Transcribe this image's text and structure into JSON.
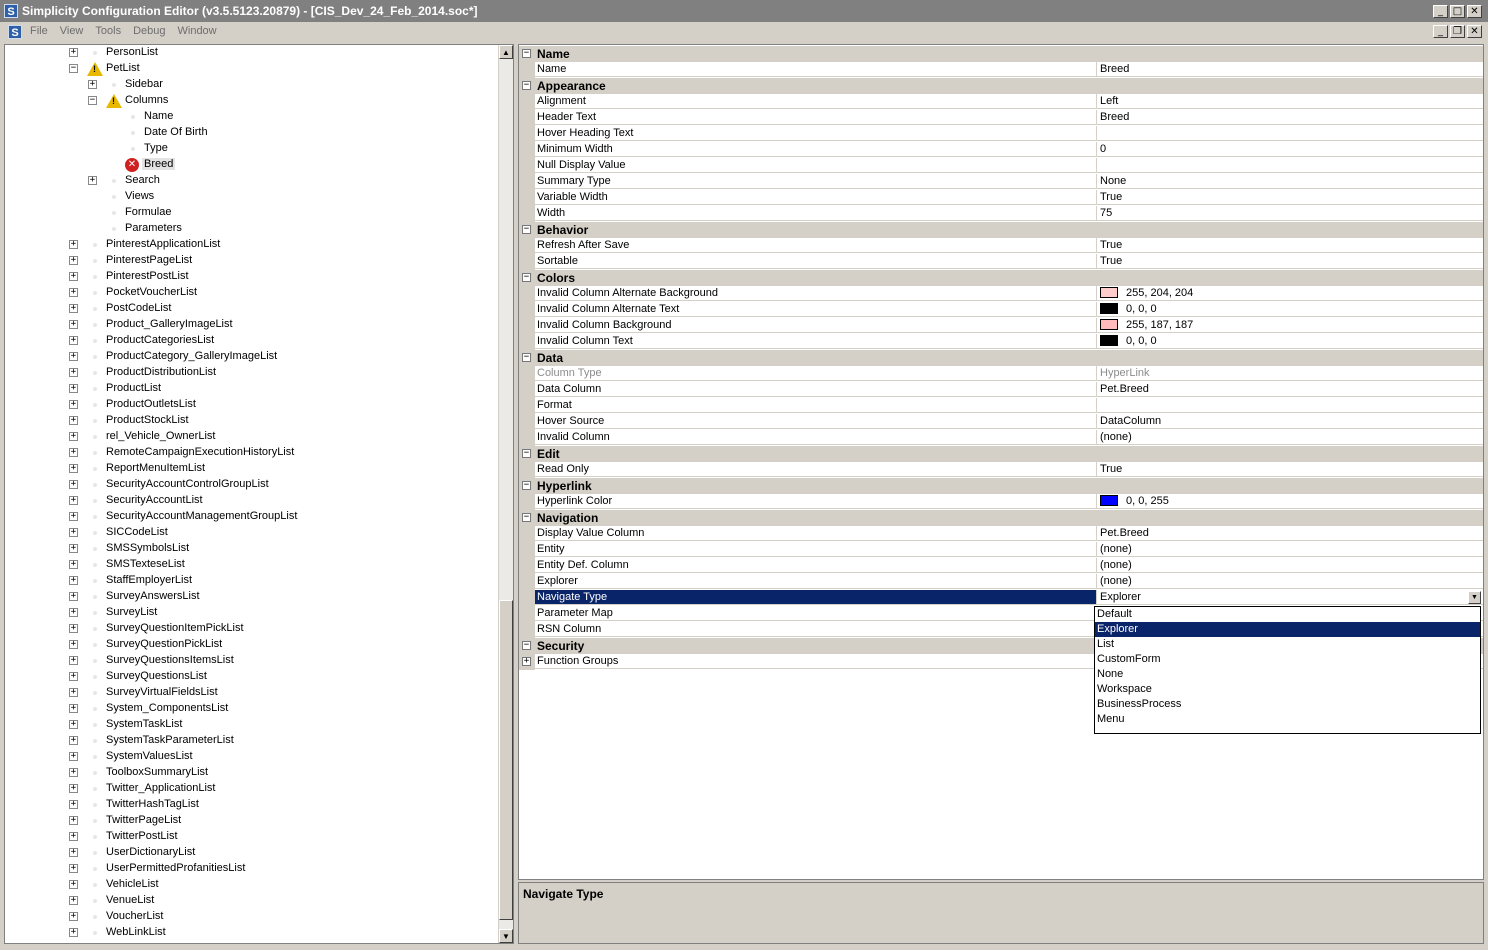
{
  "window": {
    "title": "Simplicity Configuration Editor (v3.5.5123.20879) - [CIS_Dev_24_Feb_2014.soc*]",
    "app_icon": "S",
    "minimize": "_",
    "maximize": "□",
    "restore": "❐",
    "close": "✕"
  },
  "menubar": {
    "items": [
      "File",
      "View",
      "Tools",
      "Debug",
      "Window"
    ]
  },
  "tree": {
    "items": [
      {
        "label": "PersonList",
        "level": 0,
        "expander": "+",
        "icon": "dot"
      },
      {
        "label": "PetList",
        "level": 0,
        "expander": "−",
        "icon": "warning"
      },
      {
        "label": "Sidebar",
        "level": 1,
        "expander": "+",
        "icon": "dot"
      },
      {
        "label": "Columns",
        "level": 1,
        "expander": "−",
        "icon": "warning"
      },
      {
        "label": "Name",
        "level": 2,
        "expander": "",
        "icon": "dot"
      },
      {
        "label": "Date Of Birth",
        "level": 2,
        "expander": "",
        "icon": "dot"
      },
      {
        "label": "Type",
        "level": 2,
        "expander": "",
        "icon": "dot"
      },
      {
        "label": "Breed",
        "level": 2,
        "expander": "",
        "icon": "error",
        "selected": true
      },
      {
        "label": "Search",
        "level": 1,
        "expander": "+",
        "icon": "dot"
      },
      {
        "label": "Views",
        "level": 1,
        "expander": "",
        "icon": "dot"
      },
      {
        "label": "Formulae",
        "level": 1,
        "expander": "",
        "icon": "dot"
      },
      {
        "label": "Parameters",
        "level": 1,
        "expander": "",
        "icon": "dot"
      },
      {
        "label": "PinterestApplicationList",
        "level": 0,
        "expander": "+",
        "icon": "dot"
      },
      {
        "label": "PinterestPageList",
        "level": 0,
        "expander": "+",
        "icon": "dot"
      },
      {
        "label": "PinterestPostList",
        "level": 0,
        "expander": "+",
        "icon": "dot"
      },
      {
        "label": "PocketVoucherList",
        "level": 0,
        "expander": "+",
        "icon": "dot"
      },
      {
        "label": "PostCodeList",
        "level": 0,
        "expander": "+",
        "icon": "dot"
      },
      {
        "label": "Product_GalleryImageList",
        "level": 0,
        "expander": "+",
        "icon": "dot"
      },
      {
        "label": "ProductCategoriesList",
        "level": 0,
        "expander": "+",
        "icon": "dot"
      },
      {
        "label": "ProductCategory_GalleryImageList",
        "level": 0,
        "expander": "+",
        "icon": "dot"
      },
      {
        "label": "ProductDistributionList",
        "level": 0,
        "expander": "+",
        "icon": "dot"
      },
      {
        "label": "ProductList",
        "level": 0,
        "expander": "+",
        "icon": "dot"
      },
      {
        "label": "ProductOutletsList",
        "level": 0,
        "expander": "+",
        "icon": "dot"
      },
      {
        "label": "ProductStockList",
        "level": 0,
        "expander": "+",
        "icon": "dot"
      },
      {
        "label": "rel_Vehicle_OwnerList",
        "level": 0,
        "expander": "+",
        "icon": "dot"
      },
      {
        "label": "RemoteCampaignExecutionHistoryList",
        "level": 0,
        "expander": "+",
        "icon": "dot"
      },
      {
        "label": "ReportMenuItemList",
        "level": 0,
        "expander": "+",
        "icon": "dot"
      },
      {
        "label": "SecurityAccountControlGroupList",
        "level": 0,
        "expander": "+",
        "icon": "dot"
      },
      {
        "label": "SecurityAccountList",
        "level": 0,
        "expander": "+",
        "icon": "dot"
      },
      {
        "label": "SecurityAccountManagementGroupList",
        "level": 0,
        "expander": "+",
        "icon": "dot"
      },
      {
        "label": "SICCodeList",
        "level": 0,
        "expander": "+",
        "icon": "dot"
      },
      {
        "label": "SMSSymbolsList",
        "level": 0,
        "expander": "+",
        "icon": "dot"
      },
      {
        "label": "SMSTexteseList",
        "level": 0,
        "expander": "+",
        "icon": "dot"
      },
      {
        "label": "StaffEmployerList",
        "level": 0,
        "expander": "+",
        "icon": "dot"
      },
      {
        "label": "SurveyAnswersList",
        "level": 0,
        "expander": "+",
        "icon": "dot"
      },
      {
        "label": "SurveyList",
        "level": 0,
        "expander": "+",
        "icon": "dot"
      },
      {
        "label": "SurveyQuestionItemPickList",
        "level": 0,
        "expander": "+",
        "icon": "dot"
      },
      {
        "label": "SurveyQuestionPickList",
        "level": 0,
        "expander": "+",
        "icon": "dot"
      },
      {
        "label": "SurveyQuestionsItemsList",
        "level": 0,
        "expander": "+",
        "icon": "dot"
      },
      {
        "label": "SurveyQuestionsList",
        "level": 0,
        "expander": "+",
        "icon": "dot"
      },
      {
        "label": "SurveyVirtualFieldsList",
        "level": 0,
        "expander": "+",
        "icon": "dot"
      },
      {
        "label": "System_ComponentsList",
        "level": 0,
        "expander": "+",
        "icon": "dot"
      },
      {
        "label": "SystemTaskList",
        "level": 0,
        "expander": "+",
        "icon": "dot"
      },
      {
        "label": "SystemTaskParameterList",
        "level": 0,
        "expander": "+",
        "icon": "dot"
      },
      {
        "label": "SystemValuesList",
        "level": 0,
        "expander": "+",
        "icon": "dot"
      },
      {
        "label": "ToolboxSummaryList",
        "level": 0,
        "expander": "+",
        "icon": "dot"
      },
      {
        "label": "Twitter_ApplicationList",
        "level": 0,
        "expander": "+",
        "icon": "dot"
      },
      {
        "label": "TwitterHashTagList",
        "level": 0,
        "expander": "+",
        "icon": "dot"
      },
      {
        "label": "TwitterPageList",
        "level": 0,
        "expander": "+",
        "icon": "dot"
      },
      {
        "label": "TwitterPostList",
        "level": 0,
        "expander": "+",
        "icon": "dot"
      },
      {
        "label": "UserDictionaryList",
        "level": 0,
        "expander": "+",
        "icon": "dot"
      },
      {
        "label": "UserPermittedProfanitiesList",
        "level": 0,
        "expander": "+",
        "icon": "dot"
      },
      {
        "label": "VehicleList",
        "level": 0,
        "expander": "+",
        "icon": "dot"
      },
      {
        "label": "VenueList",
        "level": 0,
        "expander": "+",
        "icon": "dot"
      },
      {
        "label": "VoucherList",
        "level": 0,
        "expander": "+",
        "icon": "dot"
      },
      {
        "label": "WebLinkList",
        "level": 0,
        "expander": "+",
        "icon": "dot"
      }
    ],
    "scroll_up": "▲",
    "scroll_down": "▼"
  },
  "grid": {
    "rows": [
      {
        "type": "cat",
        "label": "Name",
        "expander": "−"
      },
      {
        "type": "prop",
        "name": "Name",
        "value": "Breed"
      },
      {
        "type": "cat",
        "label": "Appearance",
        "expander": "−"
      },
      {
        "type": "prop",
        "name": "Alignment",
        "value": "Left"
      },
      {
        "type": "prop",
        "name": "Header Text",
        "value": "Breed"
      },
      {
        "type": "prop",
        "name": "Hover Heading Text",
        "value": ""
      },
      {
        "type": "prop",
        "name": "Minimum Width",
        "value": "0"
      },
      {
        "type": "prop",
        "name": "Null Display Value",
        "value": ""
      },
      {
        "type": "prop",
        "name": "Summary Type",
        "value": "None"
      },
      {
        "type": "prop",
        "name": "Variable Width",
        "value": "True"
      },
      {
        "type": "prop",
        "name": "Width",
        "value": "75"
      },
      {
        "type": "cat",
        "label": "Behavior",
        "expander": "−"
      },
      {
        "type": "prop",
        "name": "Refresh After Save",
        "value": "True"
      },
      {
        "type": "prop",
        "name": "Sortable",
        "value": "True"
      },
      {
        "type": "cat",
        "label": "Colors",
        "expander": "−"
      },
      {
        "type": "prop",
        "name": "Invalid Column Alternate Background",
        "value": "255, 204, 204",
        "swatch": "#ffcccc"
      },
      {
        "type": "prop",
        "name": "Invalid Column Alternate Text",
        "value": "0, 0, 0",
        "swatch": "#000000"
      },
      {
        "type": "prop",
        "name": "Invalid Column Background",
        "value": "255, 187, 187",
        "swatch": "#ffbbbb"
      },
      {
        "type": "prop",
        "name": "Invalid Column Text",
        "value": "0, 0, 0",
        "swatch": "#000000"
      },
      {
        "type": "cat",
        "label": "Data",
        "expander": "−"
      },
      {
        "type": "prop",
        "name": "Column Type",
        "value": "HyperLink",
        "disabled": true
      },
      {
        "type": "prop",
        "name": "Data Column",
        "value": "Pet.Breed"
      },
      {
        "type": "prop",
        "name": "Format",
        "value": ""
      },
      {
        "type": "prop",
        "name": "Hover Source",
        "value": "DataColumn"
      },
      {
        "type": "prop",
        "name": "Invalid Column",
        "value": "(none)"
      },
      {
        "type": "cat",
        "label": "Edit",
        "expander": "−"
      },
      {
        "type": "prop",
        "name": "Read Only",
        "value": "True"
      },
      {
        "type": "cat",
        "label": "Hyperlink",
        "expander": "−"
      },
      {
        "type": "prop",
        "name": "Hyperlink Color",
        "value": "0, 0, 255",
        "swatch": "#0000ff"
      },
      {
        "type": "cat",
        "label": "Navigation",
        "expander": "−"
      },
      {
        "type": "prop",
        "name": "Display Value Column",
        "value": "Pet.Breed"
      },
      {
        "type": "prop",
        "name": "Entity",
        "value": "(none)"
      },
      {
        "type": "prop",
        "name": "Entity Def. Column",
        "value": "(none)"
      },
      {
        "type": "prop",
        "name": "Explorer",
        "value": "(none)"
      },
      {
        "type": "prop",
        "name": "Navigate Type",
        "value": "Explorer",
        "selected": true,
        "dropdown": true
      },
      {
        "type": "prop",
        "name": "Parameter Map",
        "value": ""
      },
      {
        "type": "prop",
        "name": "RSN Column",
        "value": ""
      },
      {
        "type": "cat",
        "label": "Security",
        "expander": "−"
      },
      {
        "type": "prop",
        "name": "Function Groups",
        "value": "",
        "expander": "+"
      }
    ]
  },
  "dropdown": {
    "options": [
      "Default",
      "Explorer",
      "List",
      "CustomForm",
      "None",
      "Workspace",
      "BusinessProcess",
      "Menu"
    ],
    "selected": "Explorer",
    "arrow": "▼"
  },
  "description": {
    "title": "Navigate Type"
  }
}
